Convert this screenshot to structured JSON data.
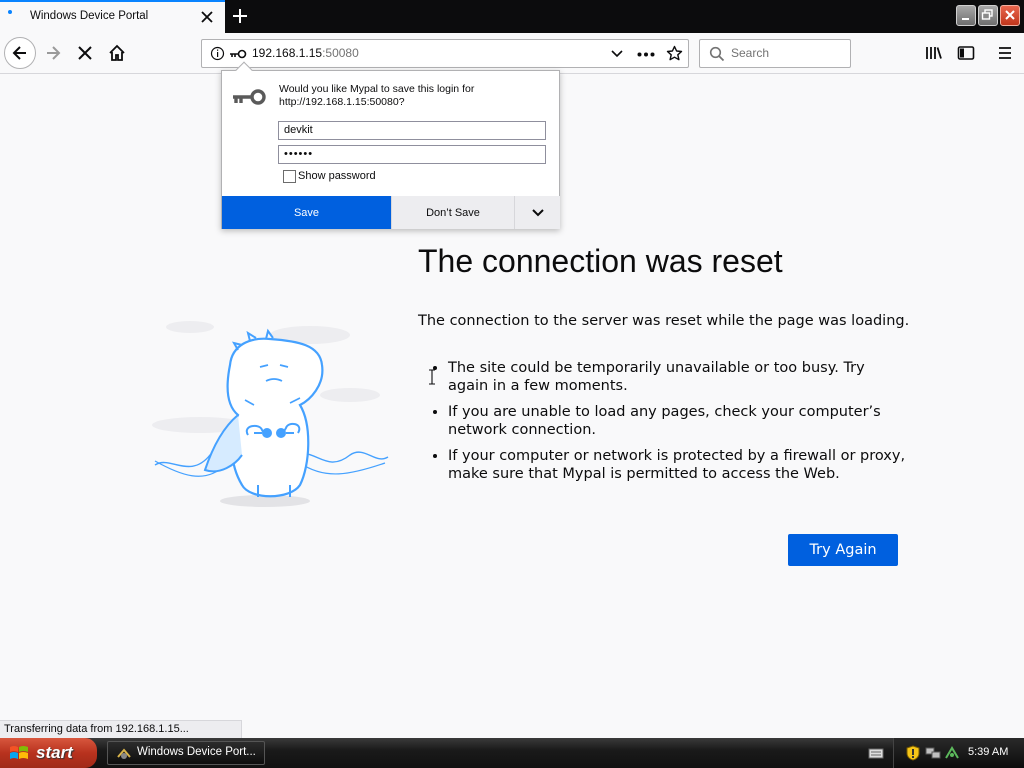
{
  "browser": {
    "tab": {
      "title": "Windows Device Portal"
    },
    "url": {
      "host": "192.168.1.15",
      "port": ":50080"
    },
    "search": {
      "placeholder": "Search"
    }
  },
  "save_login": {
    "message_line1": "Would you like Mypal to save this login for",
    "message_line2": "http://192.168.1.15:50080?",
    "username": "devkit",
    "password": "••••••",
    "show_password_label": "Show password",
    "save_label": "Save",
    "dont_save_label": "Don’t Save"
  },
  "error_page": {
    "title": "The connection was reset",
    "description": "The connection to the server was reset while the page was loading.",
    "items": [
      "The site could be temporarily unavailable or too busy. Try again in a few moments.",
      "If you are unable to load any pages, check your computer’s network connection.",
      "If your computer or network is protected by a firewall or proxy, make sure that Mypal is permitted to access the Web."
    ],
    "try_again_label": "Try Again"
  },
  "status_bar": {
    "text": "Transferring data from 192.168.1.15..."
  },
  "taskbar": {
    "start_label": "start",
    "window_label": "Windows Device Port...",
    "clock": "5:39 AM"
  },
  "colors": {
    "accent": "#0060df",
    "tab_indicator": "#0a84ff",
    "illustration": "#45a1ff"
  }
}
